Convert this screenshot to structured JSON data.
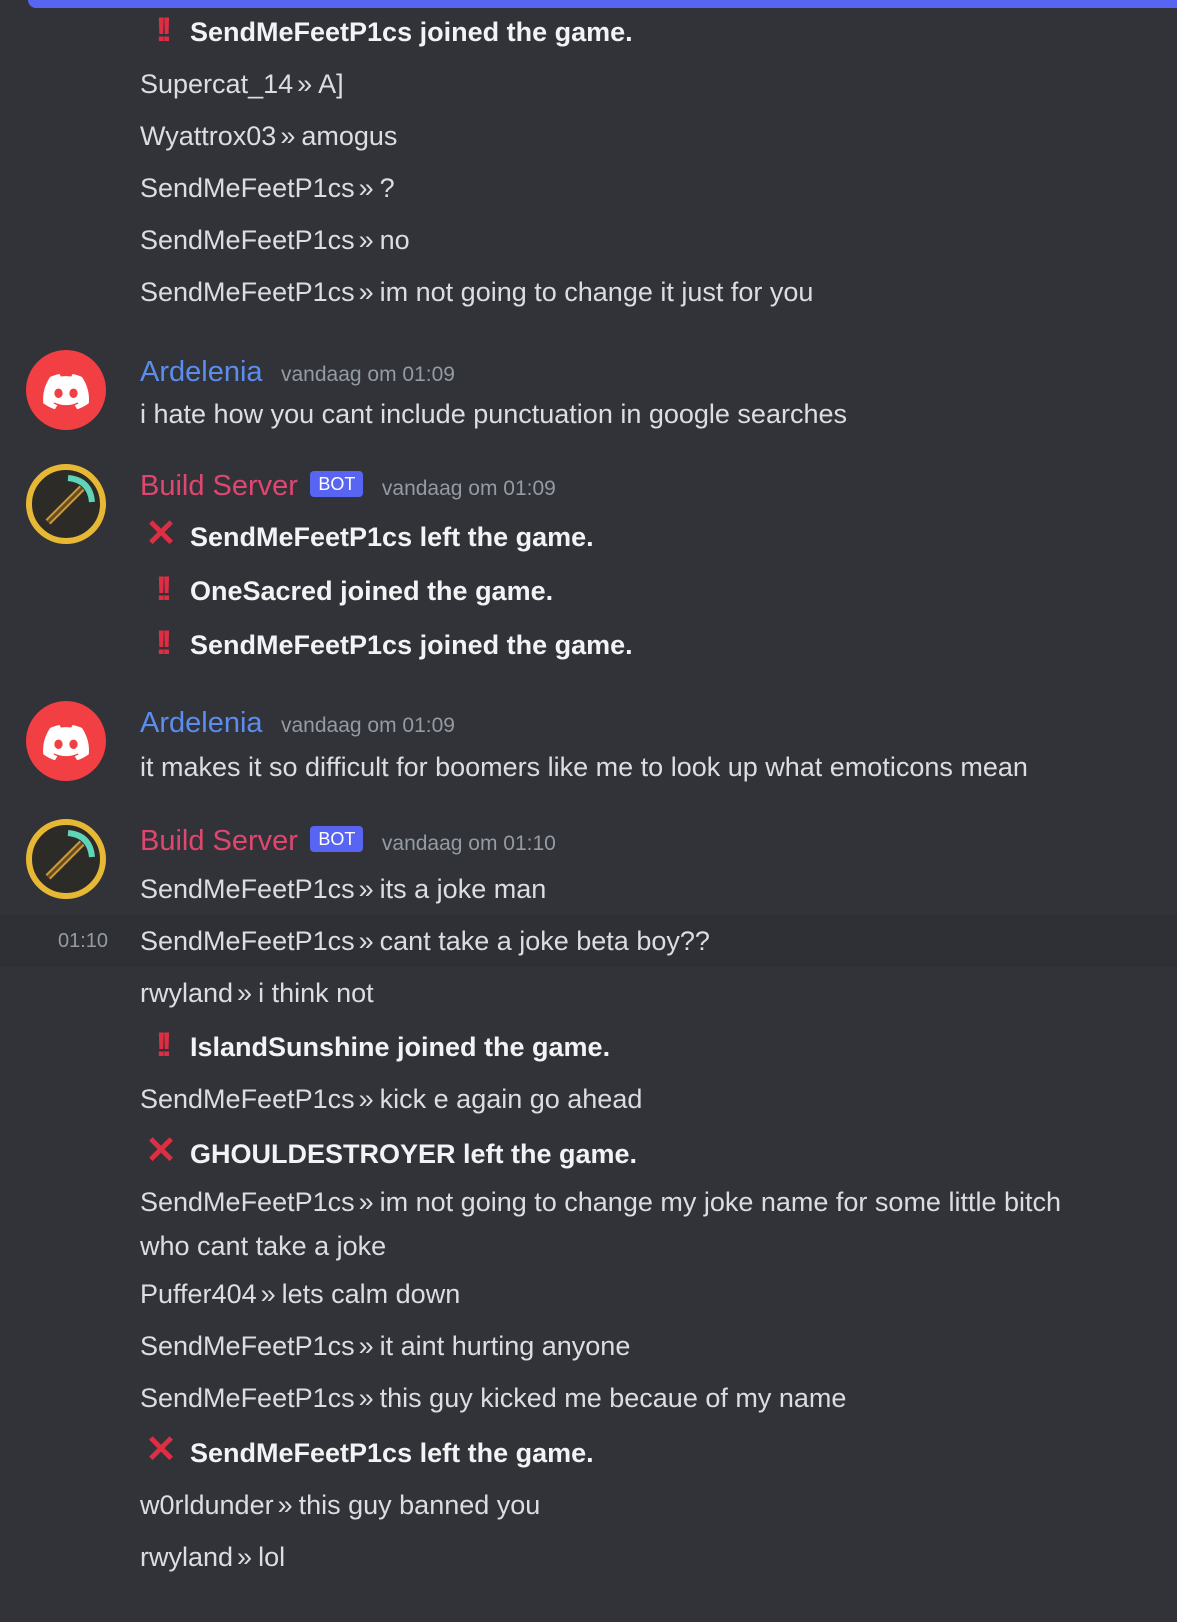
{
  "top_group": {
    "lines": [
      {
        "type": "system",
        "icon": "bang",
        "text": "SendMeFeetP1cs joined the game."
      },
      {
        "type": "chat",
        "user": "Supercat_14",
        "sep": "»",
        "msg": "A]"
      },
      {
        "type": "chat",
        "user": "Wyattrox03",
        "sep": "»",
        "msg": "amogus"
      },
      {
        "type": "chat",
        "user": "SendMeFeetP1cs",
        "sep": "»",
        "msg": "?"
      },
      {
        "type": "chat",
        "user": "SendMeFeetP1cs",
        "sep": "»",
        "msg": "no"
      },
      {
        "type": "chat",
        "user": "SendMeFeetP1cs",
        "sep": "»",
        "msg": "im not going to change it just for you"
      }
    ]
  },
  "msg1": {
    "author": "Ardelenia",
    "timestamp": "vandaag om 01:09",
    "text": "i hate how you cant include punctuation in google searches"
  },
  "msg2": {
    "author": "Build Server",
    "bot_tag": "BOT",
    "timestamp": "vandaag om 01:09",
    "lines": [
      {
        "icon": "✕",
        "text": "SendMeFeetP1cs left the game."
      },
      {
        "icon": "!!",
        "text": "OneSacred joined the game."
      },
      {
        "icon": "!!",
        "text": "SendMeFeetP1cs joined the game."
      }
    ]
  },
  "msg3": {
    "author": "Ardelenia",
    "timestamp": "vandaag om 01:09",
    "text": "it makes it so difficult for boomers like me to look up what emoticons mean"
  },
  "msg4": {
    "author": "Build Server",
    "bot_tag": "BOT",
    "timestamp": "vandaag om 01:10",
    "hover_time": "01:10",
    "lines": [
      {
        "type": "chat",
        "user": "SendMeFeetP1cs",
        "msg": "its a joke man"
      },
      {
        "type": "chat",
        "user": "SendMeFeetP1cs",
        "msg": "cant take a joke beta boy??"
      },
      {
        "type": "chat",
        "user": "rwyland",
        "msg": "i think not"
      },
      {
        "type": "system",
        "icon": "!!",
        "text": "IslandSunshine joined the game."
      },
      {
        "type": "chat",
        "user": "SendMeFeetP1cs",
        "msg": "kick e again go ahead"
      },
      {
        "type": "system",
        "icon": "✕",
        "text": "GHOULDESTROYER left the game."
      },
      {
        "type": "chat",
        "user": "SendMeFeetP1cs",
        "msg": "im not going to change my joke name for some little bitch who cant take a joke"
      },
      {
        "type": "chat",
        "user": "Puffer404",
        "msg": "lets calm down"
      },
      {
        "type": "chat",
        "user": "SendMeFeetP1cs",
        "msg": "it aint hurting anyone"
      },
      {
        "type": "chat",
        "user": "SendMeFeetP1cs",
        "msg": "this guy kicked me becaue of my name"
      },
      {
        "type": "system",
        "icon": "✕",
        "text": "SendMeFeetP1cs left the game."
      },
      {
        "type": "chat",
        "user": "w0rldunder",
        "msg": "this guy banned you"
      },
      {
        "type": "chat",
        "user": "rwyland",
        "msg": "lol"
      }
    ]
  },
  "separator": "»"
}
